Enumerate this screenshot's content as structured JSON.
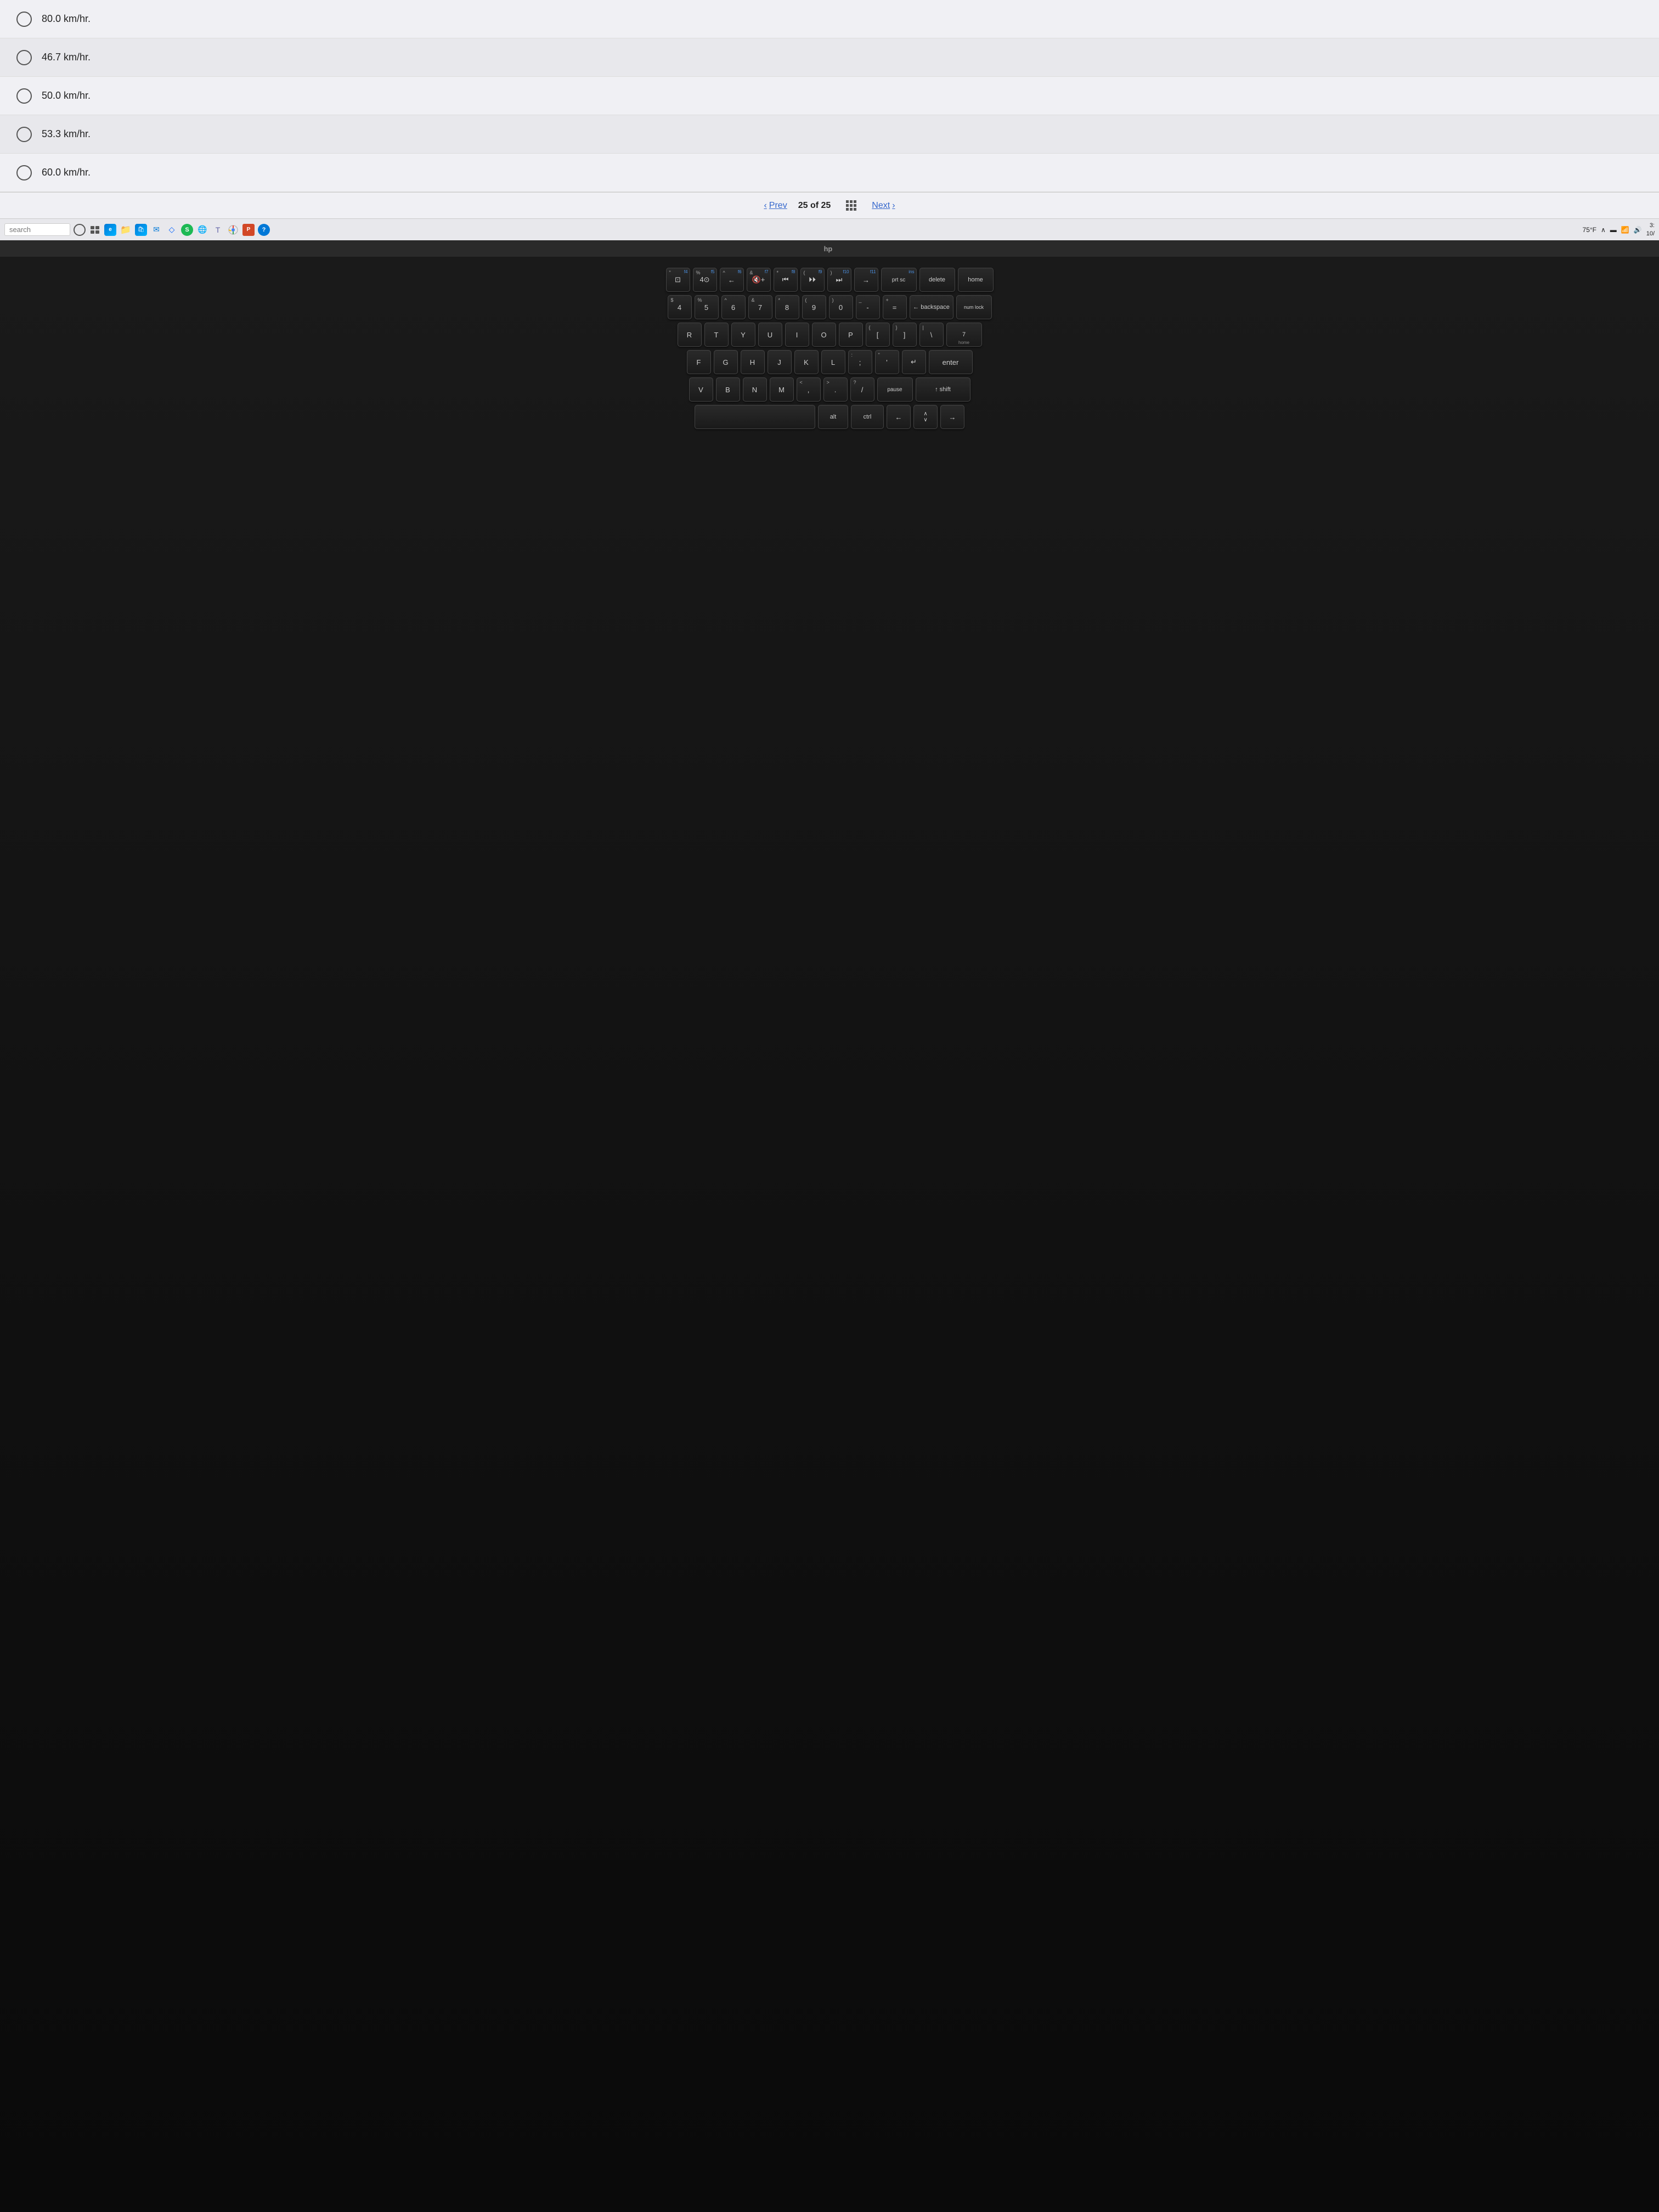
{
  "quiz": {
    "answers": [
      {
        "id": "a1",
        "text": "80.0 km/hr."
      },
      {
        "id": "a2",
        "text": "46.7 km/hr."
      },
      {
        "id": "a3",
        "text": "50.0 km/hr."
      },
      {
        "id": "a4",
        "text": "53.3 km/hr."
      },
      {
        "id": "a5",
        "text": "60.0 km/hr."
      }
    ],
    "navigation": {
      "prev_label": "Prev",
      "next_label": "Next",
      "current_page": "25",
      "total_pages": "25",
      "page_display": "25 of 25"
    }
  },
  "taskbar": {
    "search_placeholder": "search",
    "temperature": "75°F",
    "time": "3:",
    "date": "10/"
  },
  "keyboard": {
    "rows": [
      [
        "4",
        "5",
        "6",
        "7",
        "8",
        "9",
        "O",
        "-",
        "+"
      ],
      [
        "R",
        "T",
        "Y",
        "U",
        "I",
        "O",
        "P",
        "[",
        "]",
        "\\"
      ],
      [
        "F",
        "G",
        "H",
        "J",
        "K",
        "L",
        ";",
        "'"
      ],
      [
        "V",
        "B",
        "N",
        "M",
        ",",
        ".",
        "?",
        "/"
      ]
    ]
  }
}
